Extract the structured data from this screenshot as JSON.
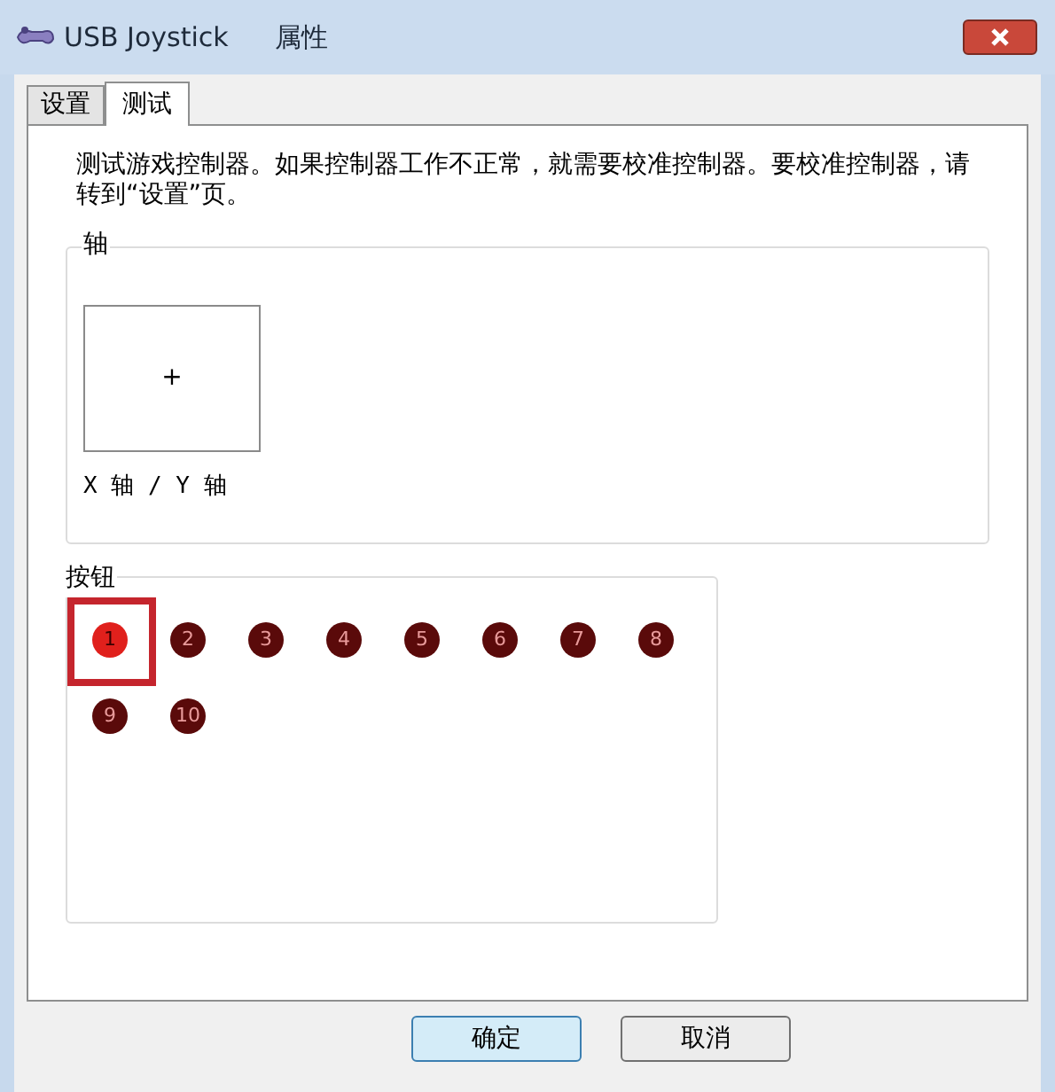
{
  "window": {
    "title": "USB Joystick",
    "subtitle": "属性"
  },
  "tabs": [
    {
      "label": "设置",
      "selected": false
    },
    {
      "label": "测试",
      "selected": true
    }
  ],
  "description": "测试游戏控制器。如果控制器工作不正常，就需要校准控制器。要校准控制器，请转到“设置”页。",
  "axes": {
    "title": "轴",
    "crosshair": "+",
    "caption": "X 轴 / Y 轴"
  },
  "buttons_group": {
    "title": "按钮",
    "buttons": [
      {
        "label": "1",
        "pressed": true,
        "highlighted": true
      },
      {
        "label": "2",
        "pressed": false,
        "highlighted": false
      },
      {
        "label": "3",
        "pressed": false,
        "highlighted": false
      },
      {
        "label": "4",
        "pressed": false,
        "highlighted": false
      },
      {
        "label": "5",
        "pressed": false,
        "highlighted": false
      },
      {
        "label": "6",
        "pressed": false,
        "highlighted": false
      },
      {
        "label": "7",
        "pressed": false,
        "highlighted": false
      },
      {
        "label": "8",
        "pressed": false,
        "highlighted": false
      },
      {
        "label": "9",
        "pressed": false,
        "highlighted": false
      },
      {
        "label": "10",
        "pressed": false,
        "highlighted": false
      }
    ]
  },
  "dialog_buttons": [
    {
      "label": "确定",
      "default": true
    },
    {
      "label": "取消",
      "default": false
    }
  ]
}
